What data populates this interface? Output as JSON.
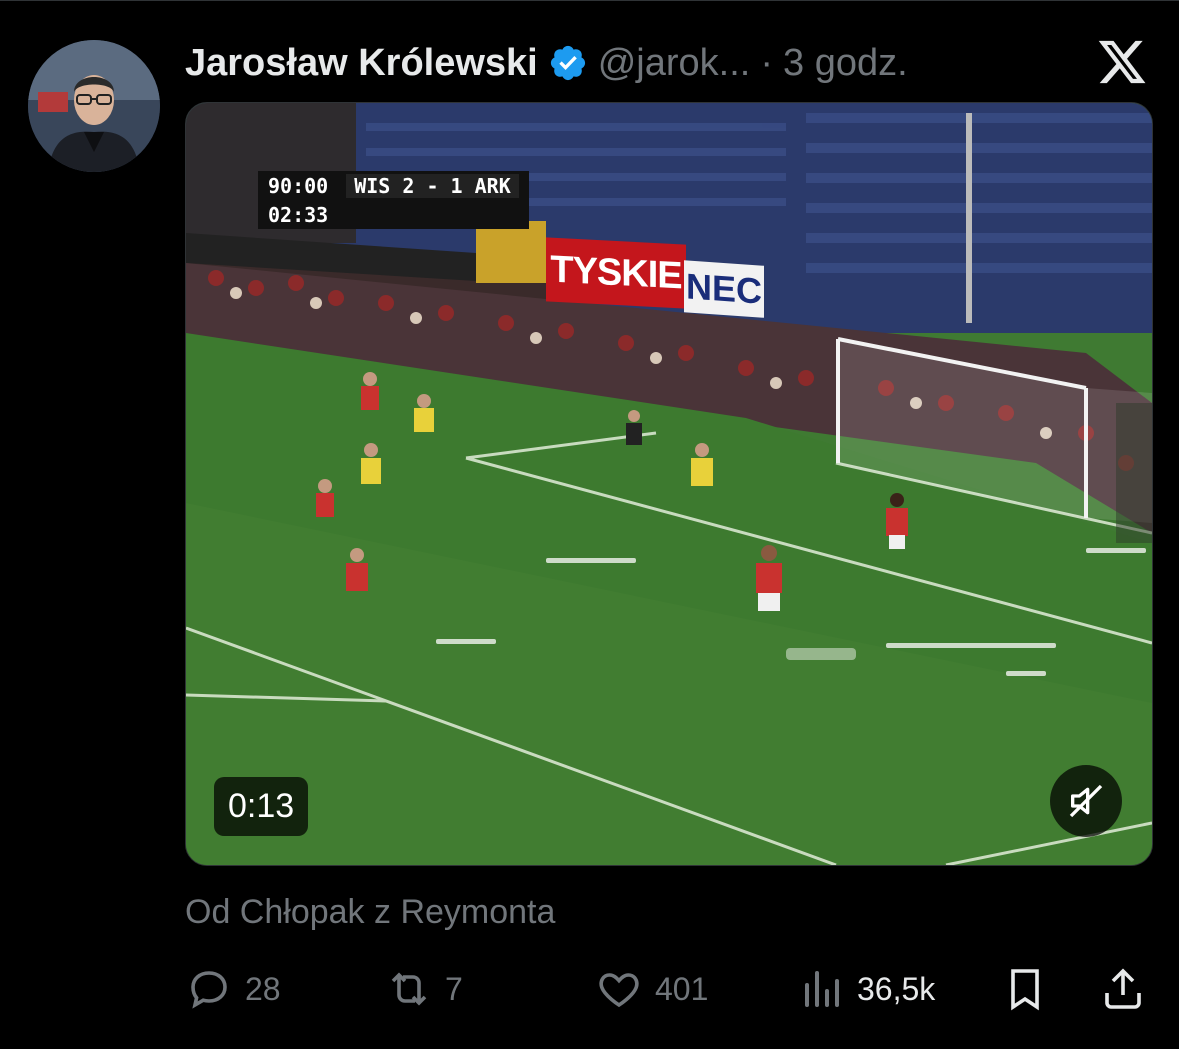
{
  "tweet": {
    "author_name": "Jarosław Królewski",
    "handle": "@jarok...",
    "separator": "·",
    "time": "3 godz.",
    "caption": "Od Chłopak z Reymonta"
  },
  "video": {
    "duration": "0:13",
    "scoreboard": {
      "match_time": "90:00",
      "score": "WIS 2 - 1 ARK",
      "added_time": "02:33"
    },
    "ads": {
      "tyskie": "TYSKIE",
      "nec": "NEC"
    }
  },
  "actions": {
    "replies": "28",
    "reposts": "7",
    "likes": "401",
    "views": "36,5k"
  },
  "icons": {
    "verified": "verified-badge-icon",
    "x_logo": "x-logo-icon",
    "mute": "muted-speaker-icon",
    "reply": "reply-icon",
    "repost": "repost-icon",
    "like": "heart-icon",
    "views": "views-icon",
    "bookmark": "bookmark-icon",
    "share": "share-icon"
  },
  "colors": {
    "background": "#000000",
    "text_primary": "#e7e9ea",
    "text_secondary": "#71767b",
    "verified_blue": "#1d9bf0"
  }
}
